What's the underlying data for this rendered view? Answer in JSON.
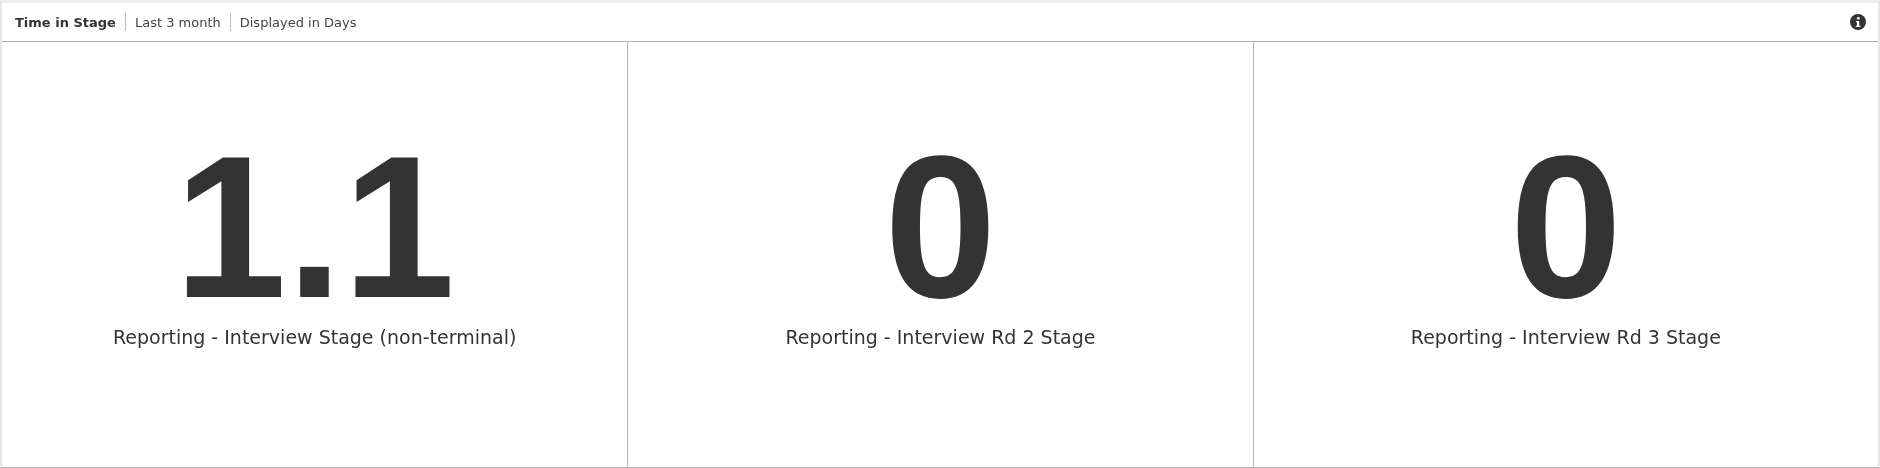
{
  "header": {
    "title": "Time in Stage",
    "period": "Last 3 month",
    "unit": "Displayed in Days"
  },
  "metrics": [
    {
      "value": "1.1",
      "label": "Reporting - Interview Stage (non-terminal)"
    },
    {
      "value": "0",
      "label": "Reporting - Interview Rd 2 Stage"
    },
    {
      "value": "0",
      "label": "Reporting - Interview Rd 3 Stage"
    }
  ]
}
